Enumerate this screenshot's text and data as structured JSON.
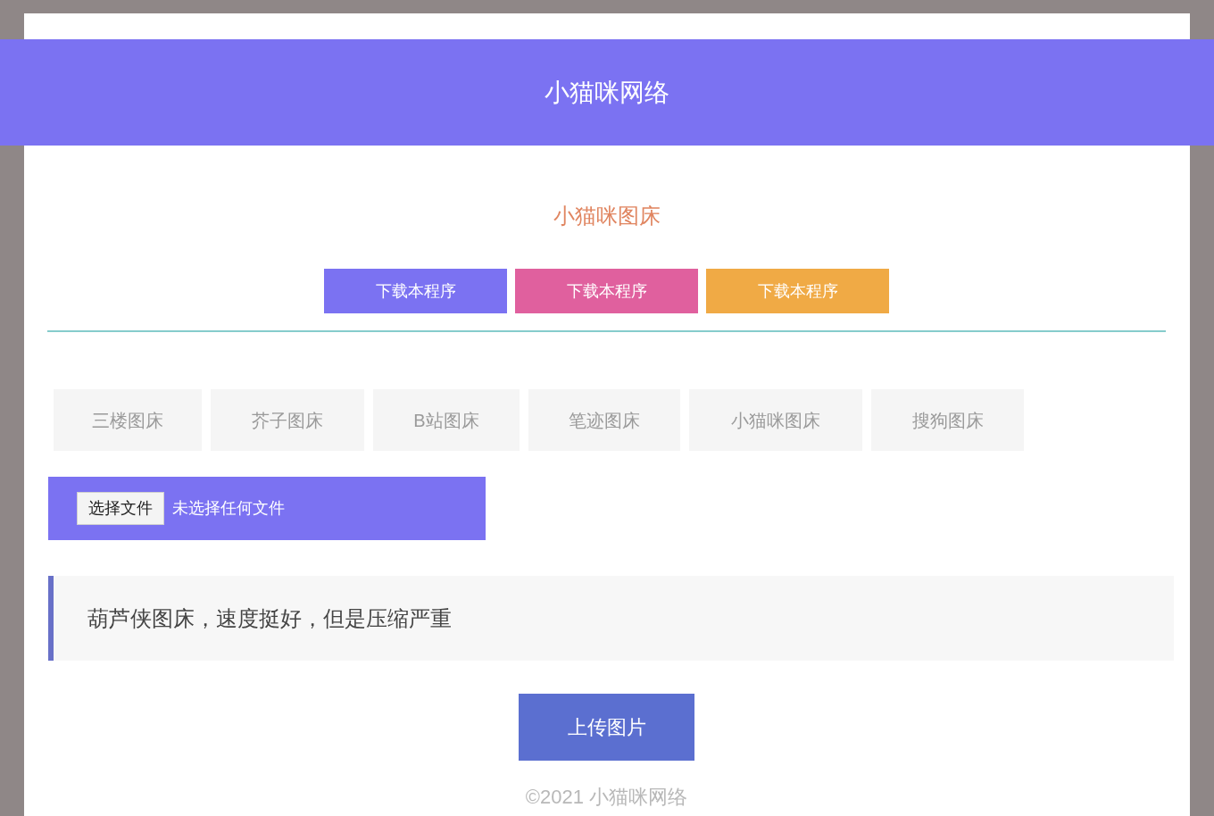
{
  "header": {
    "title": "小猫咪网络"
  },
  "subtitle": "小猫咪图床",
  "download_buttons": [
    {
      "label": "下载本程序",
      "color": "#7b72f2"
    },
    {
      "label": "下载本程序",
      "color": "#e0609e"
    },
    {
      "label": "下载本程序",
      "color": "#f0aa45"
    }
  ],
  "hosts": [
    "三楼图床",
    "芥子图床",
    "B站图床",
    "笔迹图床",
    "小猫咪图床",
    "搜狗图床"
  ],
  "file_picker": {
    "button": "选择文件",
    "status": "未选择任何文件"
  },
  "notice": "葫芦侠图床，速度挺好，但是压缩严重",
  "upload_button": "上传图片",
  "footer": "©2021 小猫咪网络"
}
